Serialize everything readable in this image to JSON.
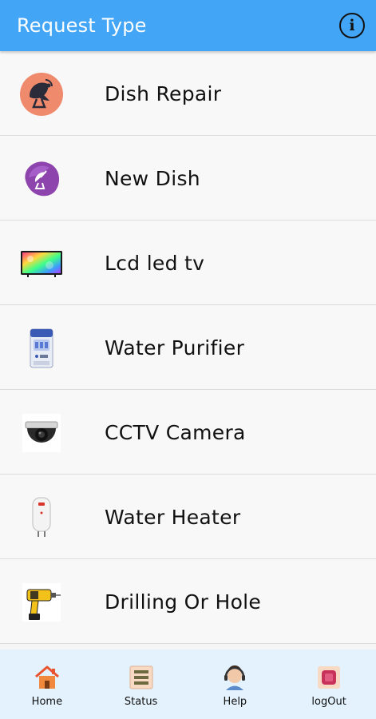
{
  "appbar": {
    "title": "Request Type",
    "info_icon": "info-icon"
  },
  "items": [
    {
      "label": "Dish Repair",
      "icon": "satellite-dish-repair-icon"
    },
    {
      "label": "New Dish",
      "icon": "satellite-dish-new-icon"
    },
    {
      "label": "Lcd led tv",
      "icon": "tv-icon"
    },
    {
      "label": "Water Purifier",
      "icon": "water-purifier-icon"
    },
    {
      "label": "CCTV Camera",
      "icon": "cctv-camera-icon"
    },
    {
      "label": "Water Heater",
      "icon": "water-heater-icon"
    },
    {
      "label": "Drilling Or Hole",
      "icon": "drill-icon"
    }
  ],
  "nav": [
    {
      "label": "Home",
      "icon": "home-icon"
    },
    {
      "label": "Status",
      "icon": "status-list-icon"
    },
    {
      "label": "Help",
      "icon": "help-support-icon"
    },
    {
      "label": "logOut",
      "icon": "logout-icon"
    }
  ],
  "colors": {
    "appbar": "#42a5f5",
    "bottom_nav": "#e3f2fd",
    "list_bg": "#f8f8f8"
  }
}
